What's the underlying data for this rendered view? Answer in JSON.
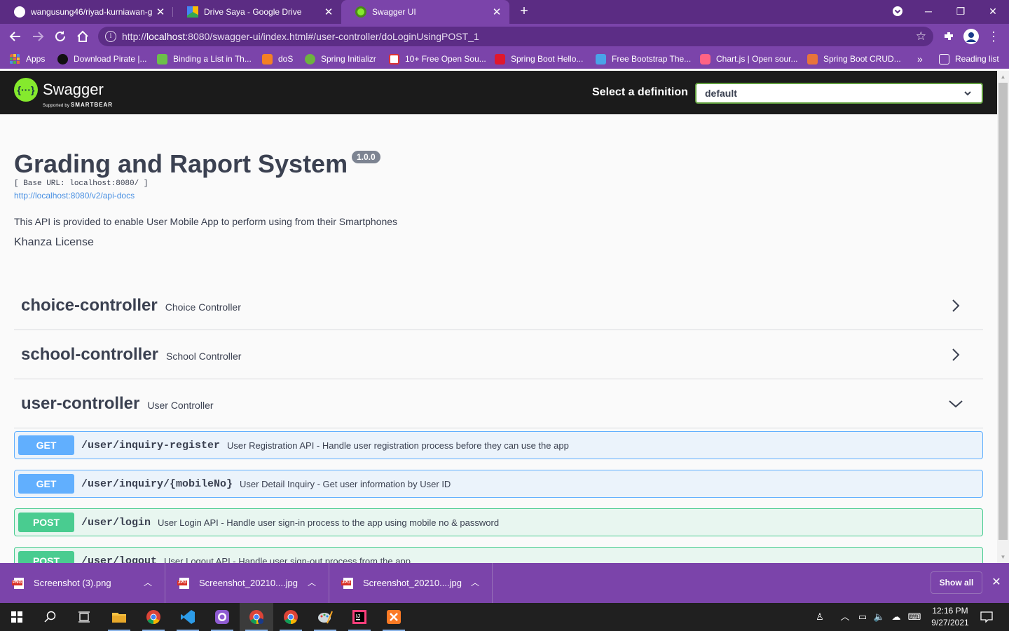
{
  "browser": {
    "tabs": [
      {
        "title": "wangusung46/riyad-kurniawan-g",
        "close": "✕",
        "icon": "github-icon"
      },
      {
        "title": "Drive Saya - Google Drive",
        "close": "✕",
        "icon": "google-drive-icon"
      },
      {
        "title": "Swagger UI",
        "close": "✕",
        "icon": "swagger-icon",
        "active": true
      }
    ],
    "new_tab": "+",
    "url_prefix": "http://",
    "url_host": "localhost",
    "url_rest": ":8080/swagger-ui/index.html#/user-controller/doLoginUsingPOST_1",
    "bookmarks": [
      {
        "label": "Apps"
      },
      {
        "label": "Download Pirate |..."
      },
      {
        "label": "Binding a List in Th..."
      },
      {
        "label": "doS"
      },
      {
        "label": "Spring Initializr"
      },
      {
        "label": "10+ Free Open Sou..."
      },
      {
        "label": "Spring Boot Hello..."
      },
      {
        "label": "Free Bootstrap The..."
      },
      {
        "label": "Chart.js | Open sour..."
      },
      {
        "label": "Spring Boot CRUD..."
      }
    ],
    "more_bookmarks": "»",
    "reading_list": "Reading list"
  },
  "swagger": {
    "brand": "Swagger",
    "brand_sub_prefix": "Supported by",
    "brand_sub_company": "SMARTBEAR",
    "select_label": "Select a definition",
    "select_value": "default",
    "title": "Grading and Raport System",
    "version": "1.0.0",
    "base_url": "[ Base URL: localhost:8080/ ]",
    "docs_link": "http://localhost:8080/v2/api-docs",
    "description": "This API is provided to enable User Mobile App to perform using from their Smartphones",
    "license": "Khanza License",
    "tags": [
      {
        "name": "choice-controller",
        "desc": "Choice Controller",
        "expanded": false
      },
      {
        "name": "school-controller",
        "desc": "School Controller",
        "expanded": false
      },
      {
        "name": "user-controller",
        "desc": "User Controller",
        "expanded": true
      }
    ],
    "operations": [
      {
        "method": "GET",
        "path": "/user/inquiry-register",
        "summary": "User Registration API - Handle user registration process before they can use the app"
      },
      {
        "method": "GET",
        "path": "/user/inquiry/{mobileNo}",
        "summary": "User Detail Inquiry - Get user information by User ID"
      },
      {
        "method": "POST",
        "path": "/user/login",
        "summary": "User Login API - Handle user sign-in process to the app using mobile no & password"
      },
      {
        "method": "POST",
        "path": "/user/logout",
        "summary": "User Logout API - Handle user sign-out process from the app"
      }
    ]
  },
  "downloads": {
    "items": [
      {
        "name": "Screenshot (3).png",
        "type": "PNG"
      },
      {
        "name": "Screenshot_20210....jpg",
        "type": "JPG"
      },
      {
        "name": "Screenshot_20210....jpg",
        "type": "JPG"
      }
    ],
    "show_all": "Show all"
  },
  "taskbar": {
    "time": "12:16 PM",
    "date": "9/27/2021"
  },
  "colors": {
    "browser_frame": "#7b44aa",
    "get": "#61affe",
    "post": "#49cc90",
    "swagger_green": "#85ea2d"
  }
}
